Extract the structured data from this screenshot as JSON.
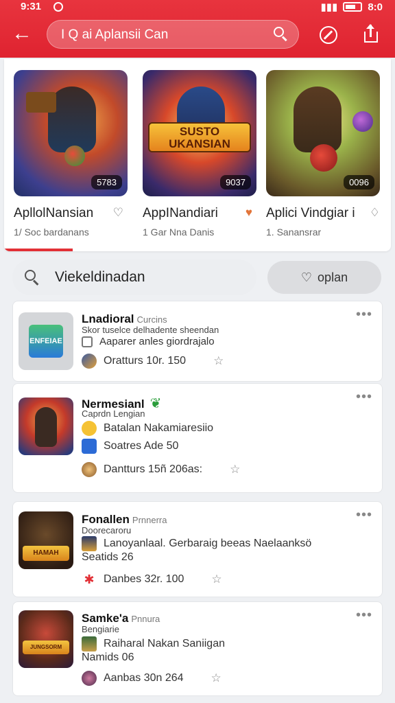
{
  "status": {
    "time": "9:31",
    "right": "8:0"
  },
  "search": {
    "query": "I Q ai Aplansii Can"
  },
  "featured": [
    {
      "title": "ApllolNansian",
      "sub": "1/ Soc bardanans",
      "badge": "5783",
      "banner": "",
      "heart": "♡"
    },
    {
      "title": "AppINandiari",
      "sub": "1 Gar Nna Danis",
      "badge": "9037",
      "banner": "SUSTO UKANSIAN",
      "heart": "♥"
    },
    {
      "title": "Aplici Vindgiar i",
      "sub": "1. Sanansrar",
      "badge": "0096",
      "banner": "",
      "heart": "♢"
    }
  ],
  "filter": {
    "query": "Viekeldinadan",
    "button": "oplan"
  },
  "cards": [
    {
      "title": "Lnadioral",
      "tag": "Curcins",
      "sub1": "Skor tuselce delhadente sheendan",
      "line1": "Aaparer anles giordrajalo",
      "line2": "Oratturs 10r. 150",
      "thumb_text": "ENFEIAE"
    },
    {
      "title": "Nermesianl",
      "tag": "",
      "sub1": "Caprdn Lengian",
      "line1": "Batalan Nakamiaresiio",
      "line2": "Soatres Ade 50",
      "line3": "Dantturs 15ñ 206as:"
    },
    {
      "title": "Fonallen",
      "tag": "Prnnerra",
      "sub1": "Doorecaroru",
      "line1": "Lanoyanlaal. Gerbaraig beeas Naelaanksö",
      "line2": "Seatids 26",
      "line3": "Danbes 32r. 100",
      "thumb_text": "HAMAH"
    },
    {
      "title": "Samke'a",
      "tag": "Pnnura",
      "sub1": "Bengiarie",
      "line1": "Raiharal Nakan Saniigan",
      "line2": "Namids 06",
      "line3": "Aanbas 30n 264",
      "thumb_text": "JUNGSORM"
    }
  ],
  "colors": {
    "accent": "#e2303a"
  }
}
